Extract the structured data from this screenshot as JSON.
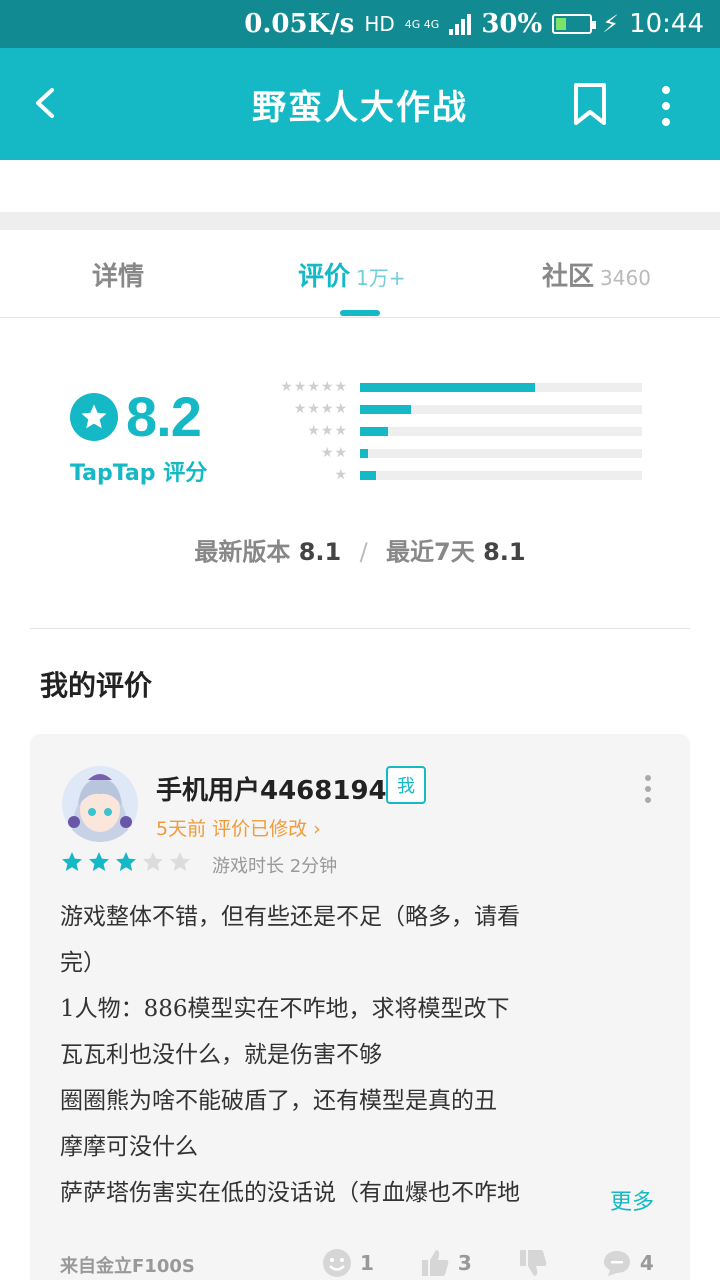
{
  "status_bar": {
    "speed": "0.05K/s",
    "hd": "HD",
    "network_top": "4G 4G",
    "battery": "30%",
    "battery_level": 0.3,
    "time": "10:44"
  },
  "app_bar": {
    "title": "野蛮人大作战"
  },
  "tabs": [
    {
      "label": "详情",
      "count": ""
    },
    {
      "label": "评价",
      "count": "1万+"
    },
    {
      "label": "社区",
      "count": "3460"
    }
  ],
  "rating": {
    "score": "8.2",
    "label": "TapTap 评分",
    "distribution": [
      {
        "stars": "★★★★★",
        "fraction": 0.62
      },
      {
        "stars": "★★★★",
        "fraction": 0.18
      },
      {
        "stars": "★★★",
        "fraction": 0.1
      },
      {
        "stars": "★★",
        "fraction": 0.03
      },
      {
        "stars": "★",
        "fraction": 0.055
      }
    ],
    "latest_version_label": "最新版本",
    "latest_version_score": "8.1",
    "separator": "/",
    "recent_label": "最近7天",
    "recent_score": "8.1"
  },
  "my_review": {
    "section_title": "我的评价",
    "username": "手机用户44681946",
    "badge": "我",
    "meta": "5天前 评价已修改 ›",
    "star_rating": 3,
    "star_max": 5,
    "playtime": "游戏时长 2分钟",
    "lines": [
      "游戏整体不错，但有些还是不足（略多，请看",
      "完）",
      "1人物：886模型实在不咋地，求将模型改下",
      "瓦瓦利也没什么，就是伤害不够",
      "圈圈熊为啥不能破盾了，还有模型是真的丑",
      "摩摩可没什么",
      "萨萨塔伤害实在低的没话说（有血爆也不咋地"
    ],
    "read_more": "更多",
    "device": "来自金立F100S",
    "actions": {
      "funny": "1",
      "like": "3",
      "dislike": "",
      "comments": "4"
    }
  },
  "colors": {
    "accent": "#15b8c5",
    "status_bar": "#118a91",
    "orange": "#f29b38"
  }
}
